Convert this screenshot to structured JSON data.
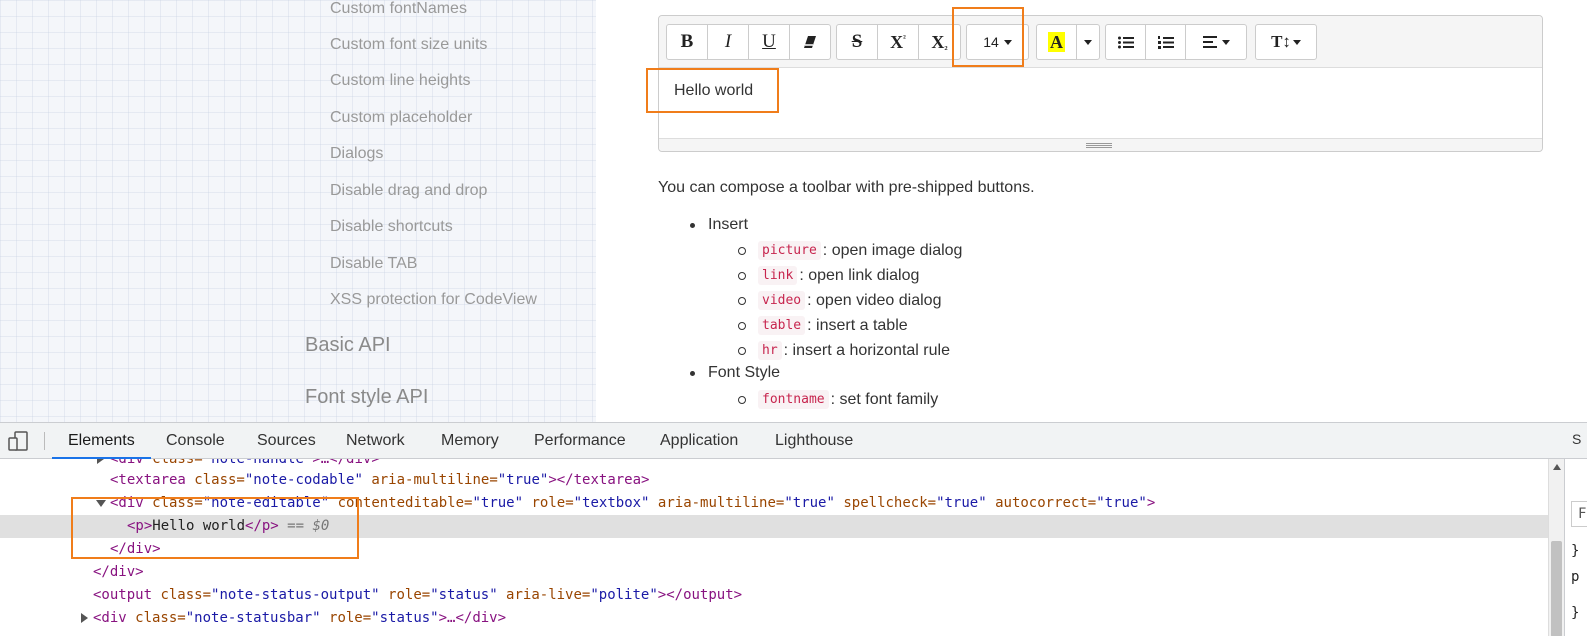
{
  "sidebar": {
    "items": [
      "Custom fontNames",
      "Custom font size units",
      "Custom line heights",
      "Custom placeholder",
      "Dialogs",
      "Disable drag and drop",
      "Disable shortcuts",
      "Disable TAB",
      "XSS protection for CodeView"
    ],
    "sections": [
      "Basic API",
      "Font style API"
    ]
  },
  "editor": {
    "font_size": "14",
    "content": "Hello world",
    "toolbar_icons": [
      "bold-icon",
      "italic-icon",
      "underline-icon",
      "eraser-icon",
      "strikethrough-icon",
      "superscript-icon",
      "subscript-icon",
      "font-size-dropdown",
      "color-a-icon",
      "unordered-list-icon",
      "ordered-list-icon",
      "align-icon",
      "line-height-icon"
    ],
    "labels": {
      "bold": "B",
      "italic": "I",
      "underline": "U",
      "strike": "S",
      "sup_base": "X",
      "sup": "²",
      "sub_base": "X",
      "sub": "₂",
      "color": "A",
      "lineheight": "T↕"
    }
  },
  "content": {
    "intro": "You can compose a toolbar with pre-shipped buttons.",
    "groups": [
      {
        "title": "Insert",
        "items": [
          {
            "code": "picture",
            "desc": ": open image dialog"
          },
          {
            "code": "link",
            "desc": ": open link dialog"
          },
          {
            "code": "video",
            "desc": ": open video dialog"
          },
          {
            "code": "table",
            "desc": ": insert a table"
          },
          {
            "code": "hr",
            "desc": ": insert a horizontal rule"
          }
        ]
      },
      {
        "title": "Font Style",
        "items": [
          {
            "code": "fontname",
            "desc": ": set font family"
          }
        ]
      }
    ]
  },
  "devtools": {
    "tabs": [
      "Elements",
      "Console",
      "Sources",
      "Network",
      "Memory",
      "Performance",
      "Application",
      "Lighthouse"
    ],
    "active_tab": "Elements",
    "dom": {
      "l0": {
        "open": "<div",
        "attr": " class=",
        "val": "\"note-handle\"",
        "rest": ">…</div>"
      },
      "l1": {
        "open": "<textarea",
        "a1": " class=",
        "v1": "\"note-codable\"",
        "a2": " aria-multiline=",
        "v2": "\"true\"",
        "close": "></textarea>"
      },
      "l2": {
        "open": "<div",
        "a1": " class=",
        "v1": "\"note-editable\"",
        "a2": " contenteditable=",
        "v2": "\"true\"",
        "a3": " role=",
        "v3": "\"textbox\"",
        "a4": " aria-multiline=",
        "v4": "\"true\"",
        "a5": " spellcheck=",
        "v5": "\"true\"",
        "a6": " autocorrect=",
        "v6": "\"true\"",
        "close": ">"
      },
      "l3": {
        "open": "<p>",
        "text": "Hello world",
        "close": "</p>",
        "marker": " == $0"
      },
      "l4": {
        "close": "</div>"
      },
      "l5": {
        "close": "</div>"
      },
      "l6": {
        "open": "<output",
        "a1": " class=",
        "v1": "\"note-status-output\"",
        "a2": " role=",
        "v2": "\"status\"",
        "a3": " aria-live=",
        "v3": "\"polite\"",
        "close": "></output>"
      },
      "l7": {
        "open": "<div",
        "a1": " class=",
        "v1": "\"note-statusbar\"",
        "a2": " role=",
        "v2": "\"status\"",
        "close": ">…</div>"
      }
    },
    "styles_fragments": [
      "}",
      "p",
      "}"
    ],
    "styles_tab_fragment": "S",
    "filter_fragment": "F"
  },
  "colors": {
    "highlight": "#f07d1a",
    "active_tab_underline": "#1a73e8",
    "code_text": "#c7254e"
  }
}
